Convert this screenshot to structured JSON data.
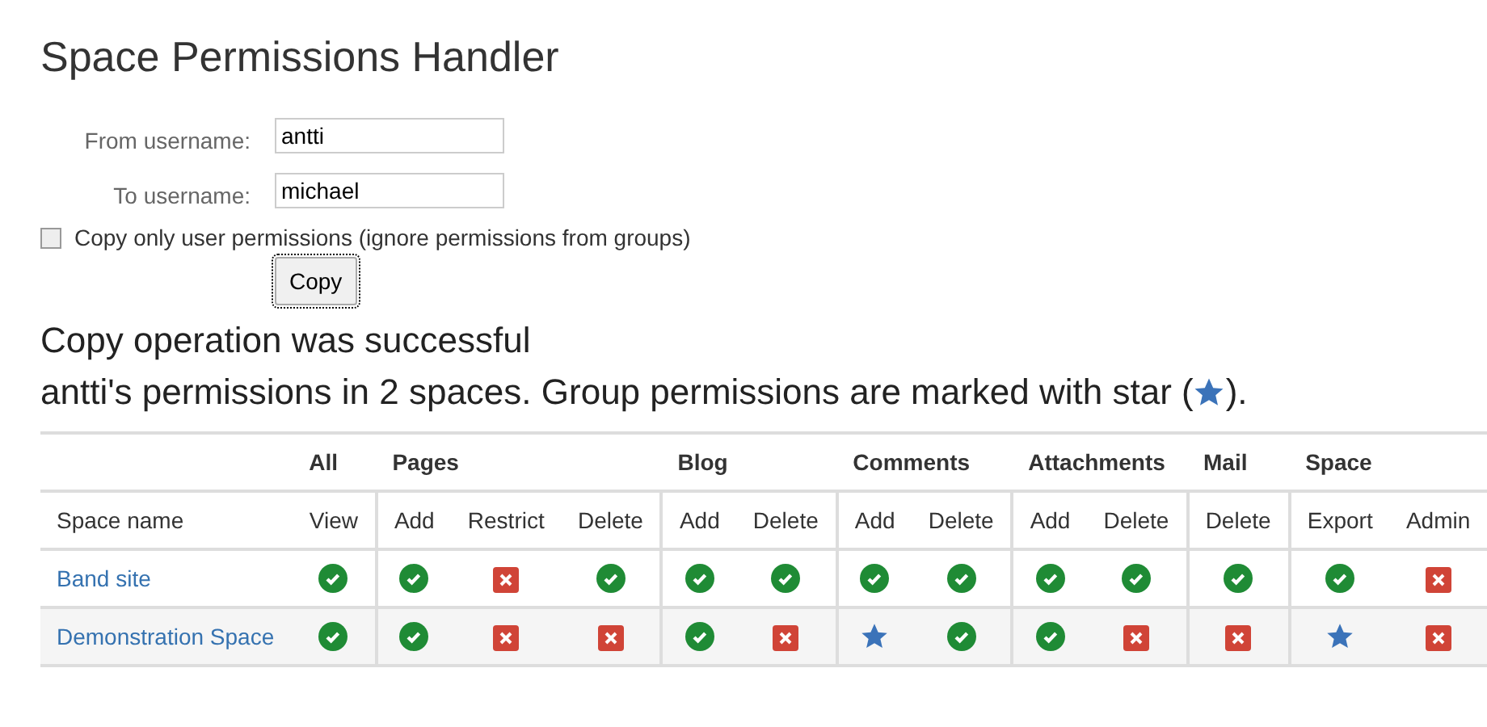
{
  "title": "Space Permissions Handler",
  "form": {
    "fields": [
      {
        "label": "From username:",
        "value": "antti"
      },
      {
        "label": "To username:",
        "value": "michael"
      }
    ],
    "checkbox": {
      "label": "Copy only user permissions (ignore permissions from groups)",
      "checked": false
    },
    "button": "Copy"
  },
  "messages": {
    "status": "Copy operation was successful",
    "summary_before": "antti's permissions in 2 spaces. Group permissions are marked with star (",
    "summary_after": ")."
  },
  "table": {
    "first_column": "Space name",
    "groups": [
      {
        "label": "All",
        "columns": [
          "View"
        ]
      },
      {
        "label": "Pages",
        "columns": [
          "Add",
          "Restrict",
          "Delete"
        ]
      },
      {
        "label": "Blog",
        "columns": [
          "Add",
          "Delete"
        ]
      },
      {
        "label": "Comments",
        "columns": [
          "Add",
          "Delete"
        ]
      },
      {
        "label": "Attachments",
        "columns": [
          "Add",
          "Delete"
        ]
      },
      {
        "label": "Mail",
        "columns": [
          "Delete"
        ]
      },
      {
        "label": "Space",
        "columns": [
          "Export",
          "Admin"
        ]
      }
    ],
    "rows": [
      {
        "name": "Band site",
        "cells": [
          {
            "kind": "check"
          },
          {
            "kind": "check"
          },
          {
            "kind": "cross"
          },
          {
            "kind": "check"
          },
          {
            "kind": "check"
          },
          {
            "kind": "check"
          },
          {
            "kind": "check"
          },
          {
            "kind": "check"
          },
          {
            "kind": "check"
          },
          {
            "kind": "check"
          },
          {
            "kind": "check"
          },
          {
            "kind": "check"
          },
          {
            "kind": "cross"
          }
        ]
      },
      {
        "name": "Demonstration Space",
        "cells": [
          {
            "kind": "check"
          },
          {
            "kind": "check"
          },
          {
            "kind": "cross"
          },
          {
            "kind": "cross"
          },
          {
            "kind": "check"
          },
          {
            "kind": "cross"
          },
          {
            "kind": "star"
          },
          {
            "kind": "check"
          },
          {
            "kind": "check"
          },
          {
            "kind": "cross"
          },
          {
            "kind": "cross"
          },
          {
            "kind": "star"
          },
          {
            "kind": "cross"
          }
        ]
      }
    ]
  }
}
